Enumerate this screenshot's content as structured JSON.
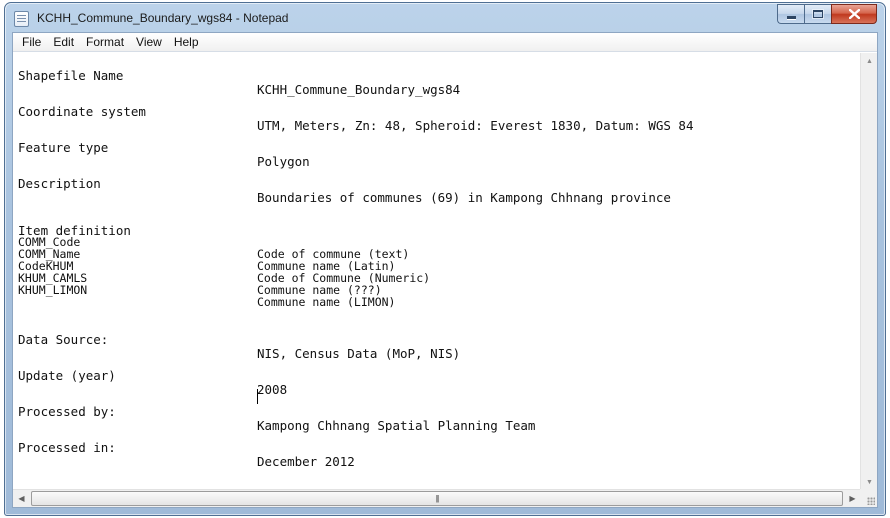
{
  "window": {
    "title": "KCHH_Commune_Boundary_wgs84 - Notepad"
  },
  "menubar": {
    "items": [
      "File",
      "Edit",
      "Format",
      "View",
      "Help"
    ]
  },
  "document": {
    "rows": [
      {
        "key": "Shapefile Name",
        "value": "KCHH_Commune_Boundary_wgs84"
      },
      {
        "key": "Coordinate system",
        "value": "UTM, Meters, Zn: 48, Spheroid: Everest 1830, Datum: WGS 84"
      },
      {
        "key": "Feature type",
        "value": "Polygon"
      },
      {
        "key": "Description",
        "value": "Boundaries of communes (69) in Kampong Chhnang province"
      },
      {
        "key": "Item definition",
        "value": ""
      },
      {
        "key": "COMM_Code",
        "value": "Code of commune (text)"
      },
      {
        "key": "COMM_Name",
        "value": "Commune name (Latin)"
      },
      {
        "key": "CodeKHUM",
        "value": "Code of Commune (Numeric)"
      },
      {
        "key": "KHUM_CAMLS",
        "value": "Commune name (???)"
      },
      {
        "key": "KHUM_LIMON",
        "value": "Commune name (LIMON)"
      },
      {
        "key": "Data Source:",
        "value": "NIS, Census Data (MoP, NIS)"
      },
      {
        "key": "Update (year)",
        "value": "2008"
      },
      {
        "key": "Processed by:",
        "value": "Kampong Chhnang Spatial Planning Team"
      },
      {
        "key": "Processed in:",
        "value": "December 2012"
      }
    ]
  },
  "icons": {
    "app": "notepad-icon",
    "minimize": "minimize-icon",
    "maximize": "maximize-icon",
    "close": "close-icon",
    "scroll_up": "scroll-up-arrow-icon",
    "scroll_down": "scroll-down-arrow-icon",
    "scroll_left": "scroll-left-arrow-icon",
    "scroll_right": "scroll-right-arrow-icon",
    "grip": "thumb-grip-icon",
    "size_grip": "size-grip-icon"
  },
  "colors": {
    "close_button": "#c0391e",
    "titlebar": "#bcd3ea"
  }
}
